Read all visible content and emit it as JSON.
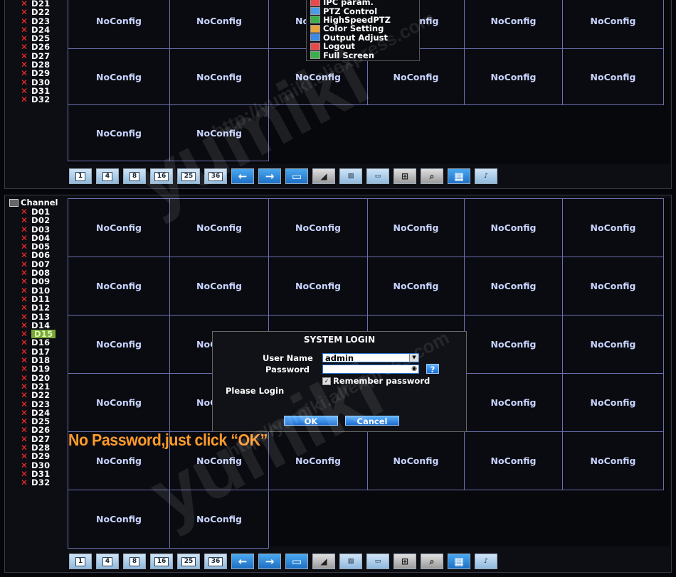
{
  "top_channels": [
    "D21",
    "D22",
    "D23",
    "D24",
    "D25",
    "D26",
    "D27",
    "D28",
    "D29",
    "D30",
    "D31",
    "D32"
  ],
  "channel_header": "Channel",
  "bottom_channels": [
    "D01",
    "D02",
    "D03",
    "D04",
    "D05",
    "D06",
    "D07",
    "D08",
    "D09",
    "D10",
    "D11",
    "D12",
    "D13",
    "D14",
    "D15",
    "D16",
    "D17",
    "D18",
    "D19",
    "D20",
    "D21",
    "D22",
    "D23",
    "D24",
    "D25",
    "D26",
    "D27",
    "D28",
    "D29",
    "D30",
    "D31",
    "D32"
  ],
  "selected_channel": "D15",
  "cell_label": "NoConfig",
  "context_menu": {
    "items": [
      {
        "label": "IPC param.",
        "icon": "ipc-param-icon"
      },
      {
        "label": "PTZ Control",
        "icon": "ptz-icon"
      },
      {
        "label": "HighSpeedPTZ",
        "icon": "highspeed-ptz-icon"
      },
      {
        "label": "Color Setting",
        "icon": "color-icon"
      },
      {
        "label": "Output Adjust",
        "icon": "output-adjust-icon"
      },
      {
        "label": "Logout",
        "icon": "logout-icon"
      },
      {
        "label": "Full Screen",
        "icon": "fullscreen-icon"
      }
    ]
  },
  "toolbar": {
    "buttons": [
      {
        "name": "layout-1-button",
        "label": "1"
      },
      {
        "name": "layout-4-button",
        "label": "4"
      },
      {
        "name": "layout-8-button",
        "label": "8"
      },
      {
        "name": "layout-16-button",
        "label": "16"
      },
      {
        "name": "layout-25-button",
        "label": "25"
      },
      {
        "name": "layout-36-button",
        "label": "36"
      },
      {
        "name": "prev-page-button",
        "label": "←",
        "icon": "arrow-left-icon"
      },
      {
        "name": "next-page-button",
        "label": "→",
        "icon": "arrow-right-icon"
      },
      {
        "name": "tour-button",
        "label": "",
        "icon": "screen-icon"
      },
      {
        "name": "ptz-button",
        "label": "",
        "icon": "camera-icon"
      },
      {
        "name": "color-button",
        "label": "",
        "icon": "image-icon"
      },
      {
        "name": "output-button",
        "label": "",
        "icon": "monitor-icon"
      },
      {
        "name": "network-button",
        "label": "",
        "icon": "network-icon"
      },
      {
        "name": "search-button",
        "label": "",
        "icon": "search-icon"
      },
      {
        "name": "qr-button",
        "label": "",
        "icon": "qr-code-icon"
      },
      {
        "name": "audio-button",
        "label": "",
        "icon": "microphone-icon"
      }
    ]
  },
  "login": {
    "title": "SYSTEM LOGIN",
    "username_label": "User Name",
    "username_value": "admin",
    "password_label": "Password",
    "password_value": "",
    "help_label": "?",
    "remember_label": "Remember password",
    "status_text": "Please Login",
    "ok_label": "OK",
    "cancel_label": "Cancel"
  },
  "caption": "No Password,just click “OK”",
  "watermark": {
    "brand": "yumiki",
    "url": "http://yumiki.aliexpress.com"
  }
}
